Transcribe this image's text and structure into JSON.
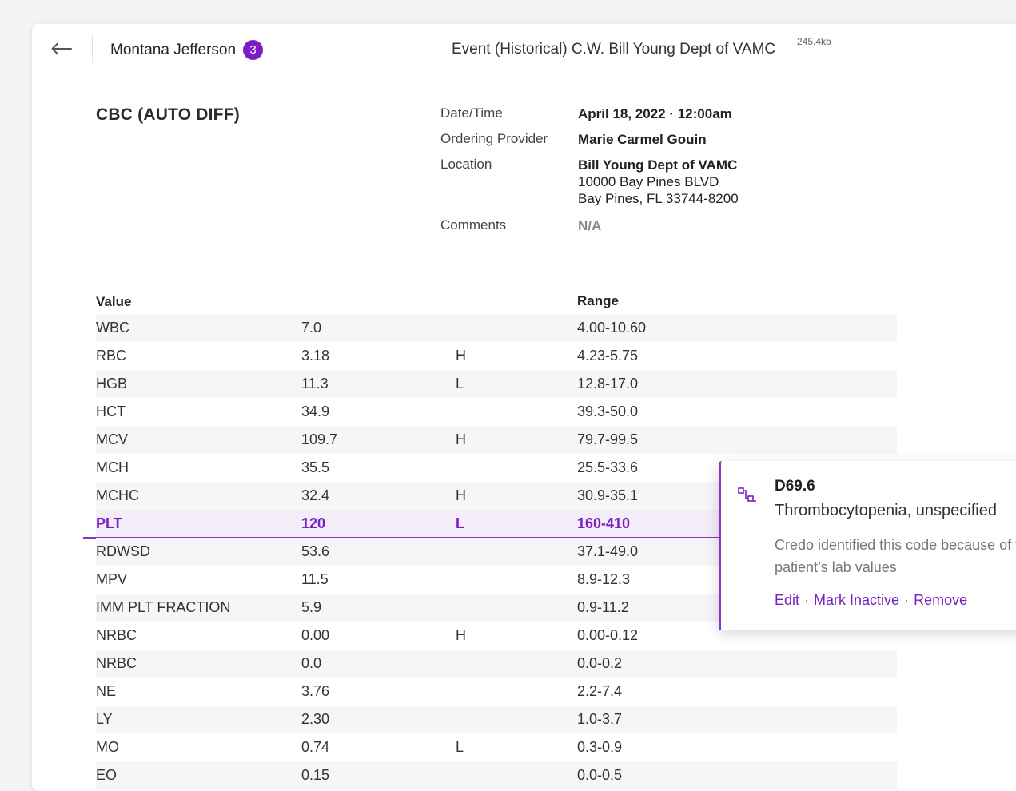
{
  "header": {
    "patient_name": "Montana Jefferson",
    "notification_count": "3",
    "event_title": "Event (Historical) C.W. Bill Young Dept of VAMC",
    "file_size": "245.4kb"
  },
  "report": {
    "test_name": "CBC (AUTO DIFF)",
    "date_label": "Date/Time",
    "date_value": "April 18, 2022 · 12:00am",
    "provider_label": "Ordering Provider",
    "provider_value": "Marie Carmel Gouin",
    "location_label": "Location",
    "location_name": "Bill Young Dept of VAMC",
    "location_street": "10000 Bay Pines BLVD",
    "location_city": "Bay Pines, FL 33744-8200",
    "comments_label": "Comments",
    "comments_value": "N/A"
  },
  "table": {
    "col_value": "Value",
    "col_range": "Range",
    "rows": [
      {
        "name": "WBC",
        "value": "7.0",
        "flag": "",
        "range": "4.00-10.60"
      },
      {
        "name": "RBC",
        "value": "3.18",
        "flag": "H",
        "range": "4.23-5.75"
      },
      {
        "name": "HGB",
        "value": "11.3",
        "flag": "L",
        "range": "12.8-17.0"
      },
      {
        "name": "HCT",
        "value": "34.9",
        "flag": "",
        "range": "39.3-50.0"
      },
      {
        "name": "MCV",
        "value": "109.7",
        "flag": "H",
        "range": "79.7-99.5"
      },
      {
        "name": "MCH",
        "value": "35.5",
        "flag": "",
        "range": "25.5-33.6"
      },
      {
        "name": "MCHC",
        "value": "32.4",
        "flag": "H",
        "range": "30.9-35.1"
      },
      {
        "name": "PLT",
        "value": "120",
        "flag": "L",
        "range": "160-410"
      },
      {
        "name": "RDWSD",
        "value": "53.6",
        "flag": "",
        "range": "37.1-49.0"
      },
      {
        "name": "MPV",
        "value": "11.5",
        "flag": "",
        "range": "8.9-12.3"
      },
      {
        "name": "IMM PLT FRACTION",
        "value": "5.9",
        "flag": "",
        "range": "0.9-11.2"
      },
      {
        "name": "NRBC",
        "value": "0.00",
        "flag": "H",
        "range": "0.00-0.12"
      },
      {
        "name": "NRBC",
        "value": "0.0",
        "flag": "",
        "range": "0.0-0.2"
      },
      {
        "name": "NE",
        "value": "3.76",
        "flag": "",
        "range": "2.2-7.4"
      },
      {
        "name": "LY",
        "value": "2.30",
        "flag": "",
        "range": "1.0-3.7"
      },
      {
        "name": "MO",
        "value": "0.74",
        "flag": "L",
        "range": "0.3-0.9"
      },
      {
        "name": "EO",
        "value": "0.15",
        "flag": "",
        "range": "0.0-0.5"
      }
    ]
  },
  "popup": {
    "code": "D69.6",
    "description": "Thrombocytopenia, unspecified",
    "explanation": "Credo identified this code because of the patient’s lab values",
    "edit_label": "Edit",
    "inactive_label": "Mark Inactive",
    "remove_label": "Remove"
  },
  "colors": {
    "accent": "#7a1fc4",
    "highlight_row": "#f4ecf8"
  }
}
